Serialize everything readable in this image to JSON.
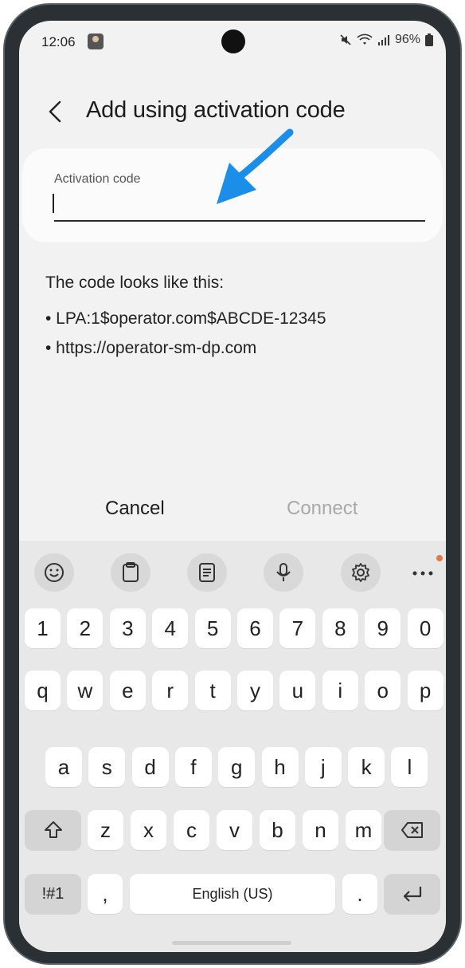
{
  "status_bar": {
    "time": "12:06",
    "battery": "96%"
  },
  "header": {
    "title": "Add using activation code"
  },
  "input": {
    "label": "Activation code",
    "value": "",
    "accent_color": "#1a8ee8"
  },
  "hint": {
    "title": "The code looks like this:",
    "lines": [
      "• LPA:1$operator.com$ABCDE-12345",
      "• https://operator-sm-dp.com"
    ]
  },
  "actions": {
    "cancel_label": "Cancel",
    "connect_label": "Connect"
  },
  "keyboard": {
    "toolbar_icons": [
      "emoji-icon",
      "clipboard-icon",
      "text-editing-icon",
      "microphone-icon",
      "settings-icon",
      "more-icon"
    ],
    "row_numbers": [
      "1",
      "2",
      "3",
      "4",
      "5",
      "6",
      "7",
      "8",
      "9",
      "0"
    ],
    "row_top": [
      "q",
      "w",
      "e",
      "r",
      "t",
      "y",
      "u",
      "i",
      "o",
      "p"
    ],
    "row_middle": [
      "a",
      "s",
      "d",
      "f",
      "g",
      "h",
      "j",
      "k",
      "l"
    ],
    "row_bottom": [
      "z",
      "x",
      "c",
      "v",
      "b",
      "n",
      "m"
    ],
    "symbols_label": "!#1",
    "comma_label": ",",
    "space_label": "English (US)",
    "period_label": "."
  }
}
